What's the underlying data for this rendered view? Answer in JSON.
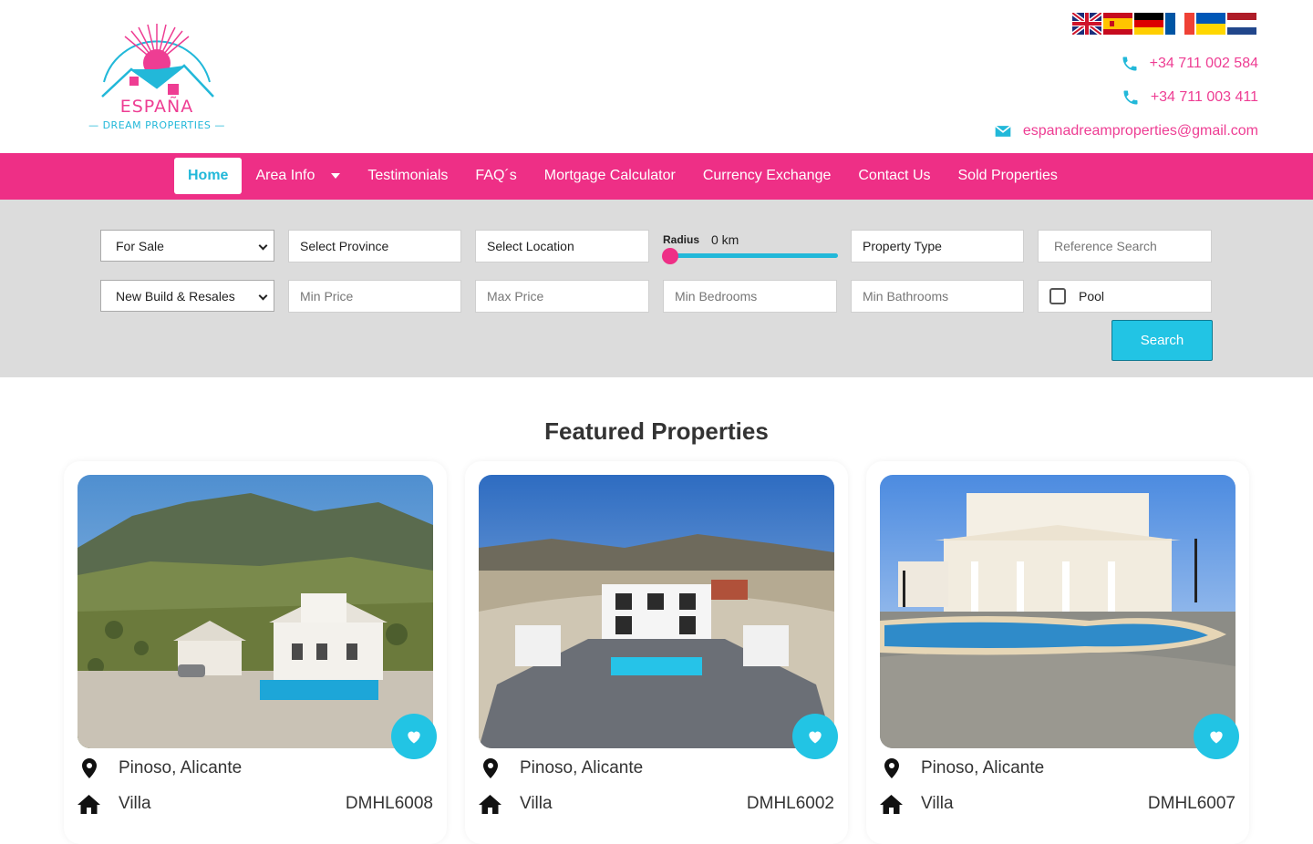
{
  "brand": {
    "name_line1": "ESPAÑA",
    "name_line2": "— DREAM PROPERTIES —",
    "accent_pink": "#ee2f86",
    "accent_cyan": "#22c4e4"
  },
  "header": {
    "languages": [
      "English",
      "Español",
      "Deutsch",
      "Français",
      "Українська",
      "Nederlands"
    ],
    "phone1": "+34 711 002 584",
    "phone2": "+34 711 003 411",
    "email": "espanadreamproperties@gmail.com"
  },
  "nav": {
    "items": [
      {
        "label": "Home",
        "active": true
      },
      {
        "label": "Area Info",
        "dropdown": true
      },
      {
        "label": "Testimonials"
      },
      {
        "label": "FAQ´s"
      },
      {
        "label": "Mortgage Calculator"
      },
      {
        "label": "Currency Exchange"
      },
      {
        "label": "Contact Us"
      },
      {
        "label": "Sold Properties"
      }
    ]
  },
  "search": {
    "status": "For Sale",
    "province": "Select Province",
    "location": "Select Location",
    "radius_label": "Radius",
    "radius_value": "0 km",
    "property_type": "Property Type",
    "reference_placeholder": "Reference Search",
    "build_type": "New Build & Resales",
    "min_price_placeholder": "Min Price",
    "max_price_placeholder": "Max Price",
    "min_bedrooms_placeholder": "Min Bedrooms",
    "min_bathrooms_placeholder": "Min Bathrooms",
    "pool_label": "Pool",
    "search_button": "Search"
  },
  "featured": {
    "title": "Featured Properties",
    "cards": [
      {
        "location": "Pinoso, Alicante",
        "type": "Villa",
        "ref": "DMHL6008"
      },
      {
        "location": "Pinoso, Alicante",
        "type": "Villa",
        "ref": "DMHL6002"
      },
      {
        "location": "Pinoso, Alicante",
        "type": "Villa",
        "ref": "DMHL6007"
      }
    ]
  }
}
